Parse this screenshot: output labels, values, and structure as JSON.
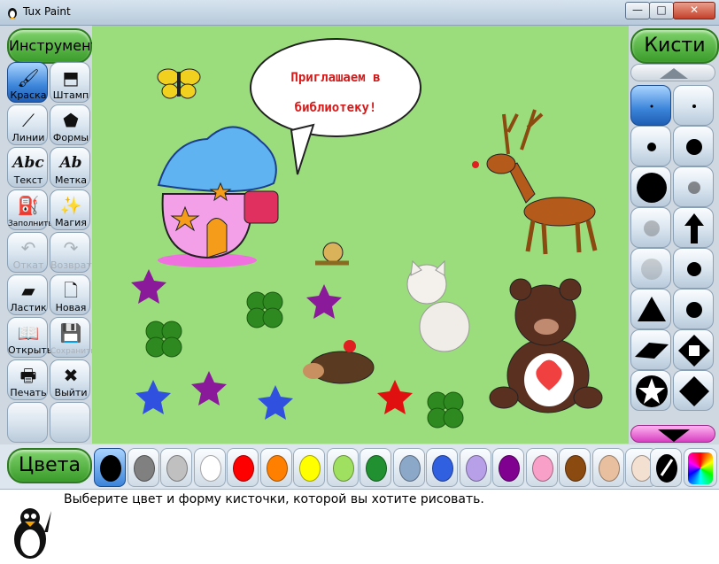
{
  "window": {
    "title": "Tux Paint",
    "min_label": "—",
    "max_label": "□",
    "close_label": "✕"
  },
  "toolbox": {
    "header": "Инструменты",
    "tools": [
      {
        "label": "Краска",
        "icon": "paint-brush-icon",
        "glyph": "🖌"
      },
      {
        "label": "Штамп",
        "icon": "stamp-icon",
        "glyph": "⬒"
      },
      {
        "label": "Линии",
        "icon": "lines-icon",
        "glyph": "⟋"
      },
      {
        "label": "Формы",
        "icon": "shapes-icon",
        "glyph": "⬟"
      },
      {
        "label": "Текст",
        "icon": "text-icon",
        "glyph": "Abc"
      },
      {
        "label": "Метка",
        "icon": "label-icon",
        "glyph": "Ab"
      },
      {
        "label": "Заполнить",
        "icon": "fill-bucket-icon",
        "glyph": "⛽"
      },
      {
        "label": "Магия",
        "icon": "magic-wand-icon",
        "glyph": "✨"
      },
      {
        "label": "Откат",
        "icon": "undo-icon",
        "glyph": "↶"
      },
      {
        "label": "Возврат",
        "icon": "redo-icon",
        "glyph": "↷"
      },
      {
        "label": "Ластик",
        "icon": "eraser-icon",
        "glyph": "▰"
      },
      {
        "label": "Новая",
        "icon": "new-page-icon",
        "glyph": "🗋"
      },
      {
        "label": "Открыть",
        "icon": "open-book-icon",
        "glyph": "📖"
      },
      {
        "label": "Сохранить",
        "icon": "save-icon",
        "glyph": "💾"
      },
      {
        "label": "Печать",
        "icon": "printer-icon",
        "glyph": "🖶"
      },
      {
        "label": "Выйти",
        "icon": "quit-icon",
        "glyph": "✖"
      }
    ]
  },
  "canvas": {
    "bubble_line1": "Приглашаем в",
    "bubble_line2": "библиотеку!"
  },
  "brushes": {
    "header": "Кисти"
  },
  "colors": {
    "header": "Цвета",
    "swatches": [
      "#000000",
      "#808080",
      "#c0c0c0",
      "#ffffff",
      "#ff0000",
      "#ff8000",
      "#ffff00",
      "#a0e060",
      "#209030",
      "#8ca8c8",
      "#3060e0",
      "#b8a0e8",
      "#800090",
      "#f8a0c8",
      "#8a4a10",
      "#e8c0a0",
      "#f4e0d0"
    ]
  },
  "status": {
    "message": "Выберите цвет и форму кисточки, которой вы хотите рисовать."
  },
  "accent": {
    "green": "#3a9b2a",
    "selected": "#3b84d9",
    "canvas": "#9bdc7c"
  }
}
